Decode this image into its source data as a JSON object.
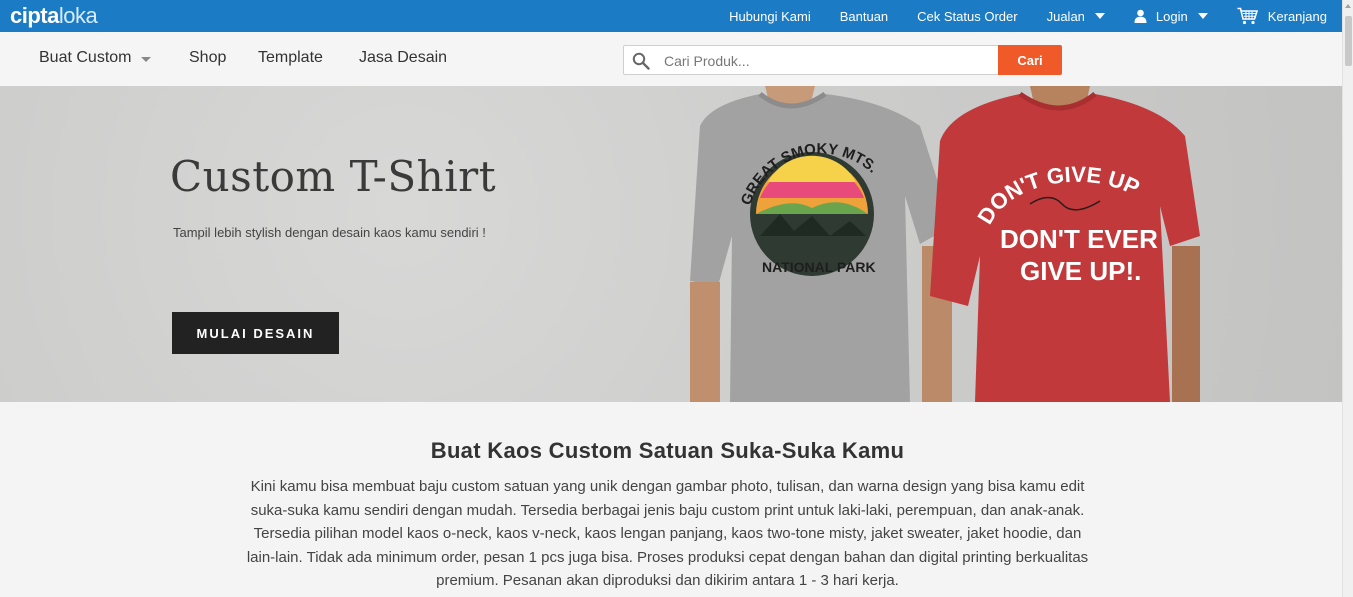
{
  "brand": {
    "part1": "cipta",
    "part2": "loka"
  },
  "topbar": {
    "links": [
      "Hubungi Kami",
      "Bantuan",
      "Cek Status Order"
    ],
    "jualan": "Jualan",
    "login": "Login",
    "cart": "Keranjang"
  },
  "nav": {
    "buat_custom": "Buat Custom",
    "shop": "Shop",
    "template": "Template",
    "jasa_desain": "Jasa Desain"
  },
  "search": {
    "placeholder": "Cari Produk...",
    "button": "Cari"
  },
  "hero": {
    "title": "Custom T-Shirt",
    "subtitle": "Tampil lebih stylish dengan desain kaos kamu sendiri !",
    "cta": "MULAI DESAIN",
    "shirt1": {
      "line1": "GREAT SMOKY MTS.",
      "line2": "NATIONAL PARK"
    },
    "shirt2": {
      "line1": "DON'T GIVE UP",
      "line2": "DON'T EVER",
      "line3": "GIVE UP!."
    }
  },
  "content": {
    "title": "Buat Kaos Custom Satuan Suka-Suka Kamu",
    "body": "Kini kamu bisa membuat baju custom satuan yang unik dengan gambar photo, tulisan, dan warna design yang bisa kamu edit suka-suka kamu sendiri dengan mudah. Tersedia berbagai jenis baju custom print untuk laki-laki, perempuan, dan anak-anak. Tersedia pilihan model kaos o-neck, kaos v-neck, kaos lengan panjang, kaos two-tone misty, jaket sweater, jaket hoodie, dan lain-lain. Tidak ada minimum order, pesan 1 pcs juga bisa. Proses produksi cepat dengan bahan dan digital printing berkualitas premium. Pesanan akan diproduksi dan dikirim antara 1 - 3 hari kerja."
  },
  "colors": {
    "topbar": "#1b7bc4",
    "search_button": "#f05a28",
    "cta_button": "#222222",
    "red_shirt": "#c0393b",
    "grey_shirt": "#9a9a9a"
  },
  "icons": [
    "user-icon",
    "cart-icon",
    "search-icon",
    "caret-down-icon"
  ]
}
